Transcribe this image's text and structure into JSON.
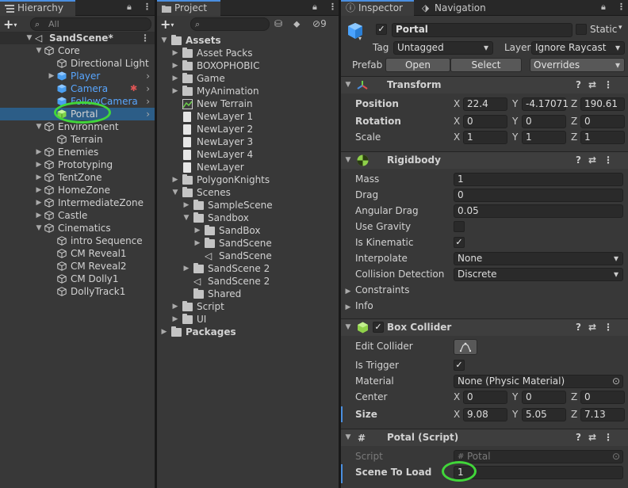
{
  "hierarchy": {
    "tab": "Hierarchy",
    "search_placeholder": "All",
    "scene": "SandScene*",
    "items": [
      {
        "label": "Core",
        "depth": 1,
        "arrow": "▼",
        "icon": "gameobject-icon"
      },
      {
        "label": "Directional Light",
        "depth": 2,
        "icon": "gameobject-icon"
      },
      {
        "label": "Player",
        "depth": 2,
        "arrow": "▶",
        "icon": "prefab-icon",
        "blue": true,
        "more": true
      },
      {
        "label": "Camera",
        "depth": 2,
        "icon": "prefab-icon",
        "blue": true,
        "more": true,
        "bug": true
      },
      {
        "label": "FollowCamera",
        "depth": 2,
        "icon": "prefab-icon",
        "blue": true,
        "more": true
      },
      {
        "label": "Portal",
        "depth": 2,
        "icon": "cube-green-icon",
        "selected": true,
        "more": true
      },
      {
        "label": "Environment",
        "depth": 1,
        "arrow": "▼",
        "icon": "gameobject-icon"
      },
      {
        "label": "Terrain",
        "depth": 2,
        "icon": "gameobject-icon"
      },
      {
        "label": "Enemies",
        "depth": 1,
        "arrow": "▶",
        "icon": "gameobject-icon"
      },
      {
        "label": "Prototyping",
        "depth": 1,
        "arrow": "▶",
        "icon": "gameobject-icon"
      },
      {
        "label": "TentZone",
        "depth": 1,
        "arrow": "▶",
        "icon": "gameobject-icon"
      },
      {
        "label": "HomeZone",
        "depth": 1,
        "arrow": "▶",
        "icon": "gameobject-icon"
      },
      {
        "label": "IntermediateZone",
        "depth": 1,
        "arrow": "▶",
        "icon": "gameobject-icon"
      },
      {
        "label": "Castle",
        "depth": 1,
        "arrow": "▶",
        "icon": "gameobject-icon"
      },
      {
        "label": "Cinematics",
        "depth": 1,
        "arrow": "▼",
        "icon": "gameobject-icon"
      },
      {
        "label": "intro Sequence",
        "depth": 2,
        "icon": "gameobject-icon"
      },
      {
        "label": "CM Reveal1",
        "depth": 2,
        "icon": "gameobject-icon"
      },
      {
        "label": "CM Reveal2",
        "depth": 2,
        "icon": "gameobject-icon"
      },
      {
        "label": "CM Dolly1",
        "depth": 2,
        "icon": "gameobject-icon"
      },
      {
        "label": "DollyTrack1",
        "depth": 2,
        "icon": "gameobject-icon"
      }
    ]
  },
  "project": {
    "tab": "Project",
    "hidden_count": "9",
    "items": [
      {
        "label": "Assets",
        "depth": 0,
        "arrow": "▼",
        "icon": "folder",
        "bold": true
      },
      {
        "label": "Asset Packs",
        "depth": 1,
        "arrow": "▶",
        "icon": "folder"
      },
      {
        "label": "BOXOPHOBIC",
        "depth": 1,
        "arrow": "▶",
        "icon": "folder"
      },
      {
        "label": "Game",
        "depth": 1,
        "arrow": "▶",
        "icon": "folder"
      },
      {
        "label": "MyAnimation",
        "depth": 1,
        "arrow": "▶",
        "icon": "folder"
      },
      {
        "label": "New Terrain",
        "depth": 1,
        "icon": "terrain"
      },
      {
        "label": "NewLayer 1",
        "depth": 1,
        "icon": "file"
      },
      {
        "label": "NewLayer 2",
        "depth": 1,
        "icon": "file"
      },
      {
        "label": "NewLayer 3",
        "depth": 1,
        "icon": "file"
      },
      {
        "label": "NewLayer 4",
        "depth": 1,
        "icon": "file"
      },
      {
        "label": "NewLayer",
        "depth": 1,
        "icon": "file"
      },
      {
        "label": "PolygonKnights",
        "depth": 1,
        "arrow": "▶",
        "icon": "folder"
      },
      {
        "label": "Scenes",
        "depth": 1,
        "arrow": "▼",
        "icon": "folder"
      },
      {
        "label": "SampleScene",
        "depth": 2,
        "arrow": "▶",
        "icon": "folder"
      },
      {
        "label": "Sandbox",
        "depth": 2,
        "arrow": "▼",
        "icon": "folder"
      },
      {
        "label": "SandBox",
        "depth": 3,
        "arrow": "▶",
        "icon": "folder"
      },
      {
        "label": "SandScene",
        "depth": 3,
        "arrow": "▶",
        "icon": "folder"
      },
      {
        "label": "SandScene",
        "depth": 3,
        "icon": "unity"
      },
      {
        "label": "SandScene 2",
        "depth": 2,
        "arrow": "▶",
        "icon": "folder"
      },
      {
        "label": "SandScene 2",
        "depth": 2,
        "icon": "unity"
      },
      {
        "label": "Shared",
        "depth": 2,
        "icon": "folder"
      },
      {
        "label": "Script",
        "depth": 1,
        "arrow": "▶",
        "icon": "folder"
      },
      {
        "label": "UI",
        "depth": 1,
        "arrow": "▶",
        "icon": "folder"
      },
      {
        "label": "Packages",
        "depth": 0,
        "arrow": "▶",
        "icon": "folder",
        "bold": true
      }
    ]
  },
  "inspector": {
    "tabs": [
      "Inspector",
      "Navigation"
    ],
    "object_name": "Portal",
    "static_label": "Static",
    "tag_label": "Tag",
    "tag_value": "Untagged",
    "layer_label": "Layer",
    "layer_value": "Ignore Raycast",
    "prefab_label": "Prefab",
    "open_label": "Open",
    "select_label": "Select",
    "overrides_label": "Overrides",
    "transform": {
      "title": "Transform",
      "position_label": "Position",
      "rotation_label": "Rotation",
      "scale_label": "Scale",
      "position": [
        "22.4",
        "-4.17071",
        "190.61"
      ],
      "rotation": [
        "0",
        "0",
        "0"
      ],
      "scale": [
        "1",
        "1",
        "1"
      ]
    },
    "rigidbody": {
      "title": "Rigidbody",
      "mass_label": "Mass",
      "mass": "1",
      "drag_label": "Drag",
      "drag": "0",
      "angular_drag_label": "Angular Drag",
      "angular_drag": "0.05",
      "use_gravity_label": "Use Gravity",
      "is_kinematic_label": "Is Kinematic",
      "interpolate_label": "Interpolate",
      "interpolate": "None",
      "collision_label": "Collision Detection",
      "collision": "Discrete",
      "constraints_label": "Constraints",
      "info_label": "Info"
    },
    "box_collider": {
      "title": "Box Collider",
      "edit_label": "Edit Collider",
      "is_trigger_label": "Is Trigger",
      "material_label": "Material",
      "material": "None (Physic Material)",
      "center_label": "Center",
      "center": [
        "0",
        "0",
        "0"
      ],
      "size_label": "Size",
      "size": [
        "9.08",
        "5.05",
        "7.13"
      ]
    },
    "portal_script": {
      "title": "Potal (Script)",
      "script_label": "Script",
      "script_value": "Potal",
      "scene_label": "Scene To Load",
      "scene_value": "1"
    },
    "axis": [
      "X",
      "Y",
      "Z"
    ],
    "check": "✓"
  }
}
